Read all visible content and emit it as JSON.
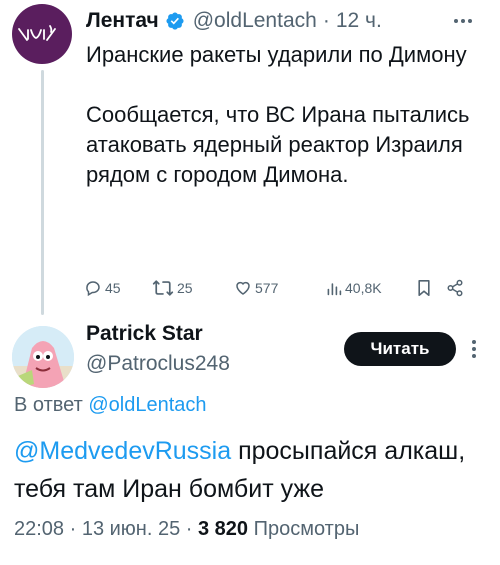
{
  "tweet1": {
    "author_name": "Лентач",
    "handle": "@oldLentach",
    "time_sep": "·",
    "time": "12 ч.",
    "avatar_text": "\\(ツ)/",
    "text_line1": "Иранские ракеты ударили по Димону",
    "text_line2": "Сообщается, что ВС Ирана пытались атаковать ядерный реактор Израиля рядом с городом Димона.",
    "actions": {
      "replies": "45",
      "retweets": "25",
      "likes": "577",
      "views": "40,8K"
    }
  },
  "tweet2": {
    "author_name": "Patrick Star",
    "handle": "@Patroclus248",
    "read_button": "Читать",
    "reply_prefix": "В ответ",
    "reply_to": "@oldLentach",
    "mention": "@MedvedevRussia",
    "text": " просыпайся алкаш, тебя там Иран бомбит уже",
    "timestamp": "22:08 · 13 июн. 25 ·",
    "views_count": "3 820",
    "views_label": "Просмотры"
  },
  "colors": {
    "accent": "#1d9bf0",
    "muted": "#536471",
    "text": "#0f1419",
    "line": "#cfd9de",
    "avatar1_bg": "#5a1e5e"
  }
}
